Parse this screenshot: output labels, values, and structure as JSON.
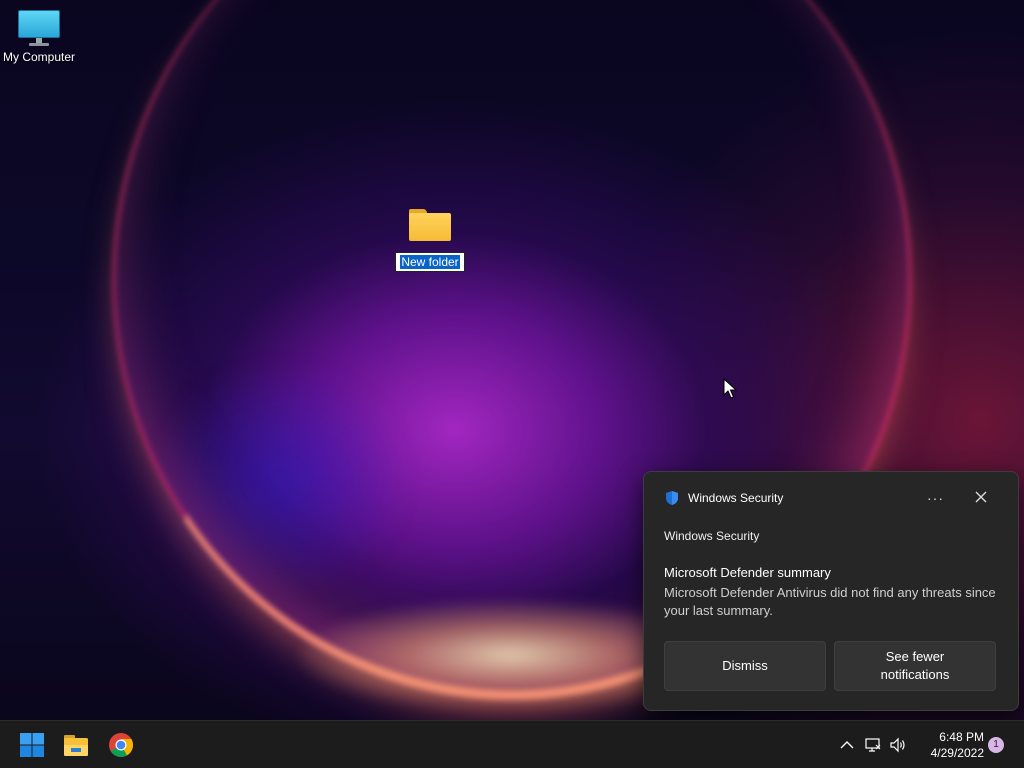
{
  "desktop": {
    "icons": [
      {
        "label": "My Computer",
        "icon": "computer-icon"
      },
      {
        "label": "New folder",
        "icon": "folder-icon",
        "renaming": true
      }
    ]
  },
  "toast": {
    "app_name": "Windows Security",
    "more_label": "···",
    "source": "Windows Security",
    "title": "Microsoft Defender summary",
    "body": "Microsoft Defender Antivirus did not find any threats since your last summary.",
    "buttons": {
      "dismiss": "Dismiss",
      "fewer": "See fewer\nnotifications"
    }
  },
  "taskbar": {
    "apps": [
      "start-icon",
      "file-explorer-icon",
      "chrome-icon"
    ],
    "clock": {
      "time": "6:48 PM",
      "date": "4/29/2022"
    },
    "notification_count": "1"
  },
  "colors": {
    "accent": "#0a64c8",
    "toast_bg": "#262626",
    "taskbar_bg": "#1c1c1c",
    "badge": "#d8b6e6"
  }
}
